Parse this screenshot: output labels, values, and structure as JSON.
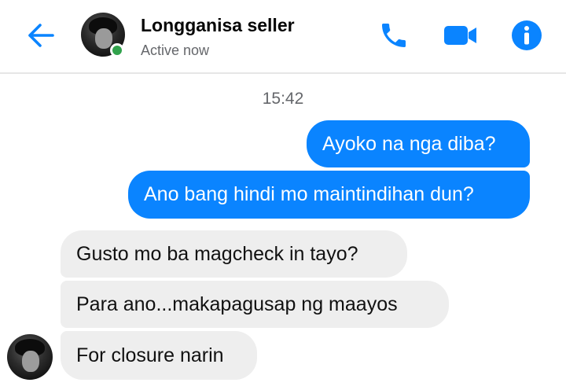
{
  "header": {
    "contact_name": "Longganisa seller",
    "status": "Active now",
    "icons": {
      "back": "back-arrow-icon",
      "call": "phone-icon",
      "video": "video-camera-icon",
      "info": "info-icon"
    },
    "accent_color": "#0a84ff",
    "online_color": "#31a24c"
  },
  "conversation": {
    "timestamp": "15:42",
    "messages": [
      {
        "sender": "me",
        "text": "Ayoko na nga diba?"
      },
      {
        "sender": "me",
        "text": "Ano bang hindi mo maintindihan dun?"
      },
      {
        "sender": "contact",
        "text": "Gusto mo ba magcheck in tayo?"
      },
      {
        "sender": "contact",
        "text": "Para ano...makapagusap ng maayos"
      },
      {
        "sender": "contact",
        "text": "For closure narin"
      }
    ]
  }
}
